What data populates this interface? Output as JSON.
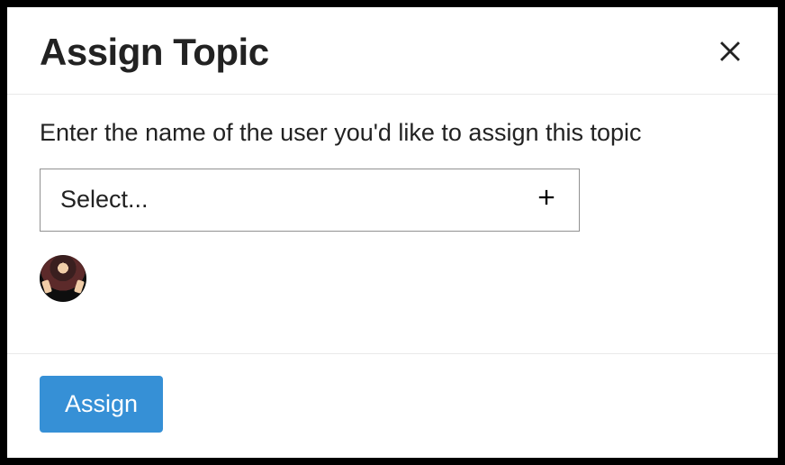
{
  "modal": {
    "title": "Assign Topic",
    "instruction": "Enter the name of the user you'd like to assign this topic",
    "select_placeholder": "Select...",
    "assign_button": "Assign",
    "suggestions": [
      {
        "id": "user-1"
      }
    ]
  },
  "icons": {
    "close": "close-icon",
    "plus": "plus-icon"
  },
  "colors": {
    "primary": "#3690d6",
    "border": "#919191",
    "divider": "#e9e9e9"
  }
}
